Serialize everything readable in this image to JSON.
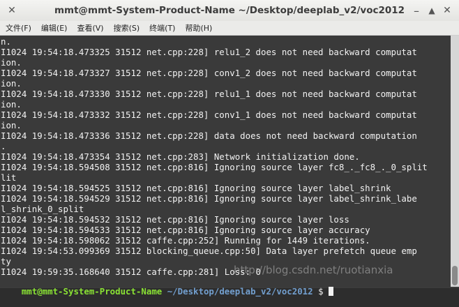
{
  "window": {
    "title": "mmt@mmt-System-Product-Name ~/Desktop/deeplab_v2/voc2012",
    "close_glyph": "✕",
    "min_glyph": "–",
    "max_glyph": "▲",
    "close2_glyph": "✕"
  },
  "menu": [
    "文件(F)",
    "编辑(E)",
    "查看(V)",
    "搜索(S)",
    "终端(T)",
    "帮助(H)"
  ],
  "terminal": {
    "lines": [
      "n.",
      "I1024 19:54:18.473325 31512 net.cpp:228] relu1_2 does not need backward computat",
      "ion.",
      "I1024 19:54:18.473327 31512 net.cpp:228] conv1_2 does not need backward computat",
      "ion.",
      "I1024 19:54:18.473330 31512 net.cpp:228] relu1_1 does not need backward computat",
      "ion.",
      "I1024 19:54:18.473332 31512 net.cpp:228] conv1_1 does not need backward computat",
      "ion.",
      "I1024 19:54:18.473336 31512 net.cpp:228] data does not need backward computation",
      ".",
      "I1024 19:54:18.473354 31512 net.cpp:283] Network initialization done.",
      "I1024 19:54:18.594508 31512 net.cpp:816] Ignoring source layer fc8_._fc8_._0_split",
      "lit",
      "I1024 19:54:18.594525 31512 net.cpp:816] Ignoring source layer label_shrink",
      "I1024 19:54:18.594529 31512 net.cpp:816] Ignoring source layer label_shrink_labe",
      "l_shrink_0_split",
      "I1024 19:54:18.594532 31512 net.cpp:816] Ignoring source layer loss",
      "I1024 19:54:18.594533 31512 net.cpp:816] Ignoring source layer accuracy",
      "I1024 19:54:18.598062 31512 caffe.cpp:252] Running for 1449 iterations.",
      "I1024 19:54:53.099369 31512 blocking_queue.cpp:50] Data layer prefetch queue emp",
      "ty",
      "I1024 19:59:35.168640 31512 caffe.cpp:281] Loss: 0"
    ],
    "prompt_user": "mmt@mmt-System-Product-Name",
    "prompt_path": " ~/Desktop/deeplab_v2/voc2012",
    "prompt_dollar": " $ "
  },
  "watermark": "http://blog.csdn.net/ruotianxia"
}
